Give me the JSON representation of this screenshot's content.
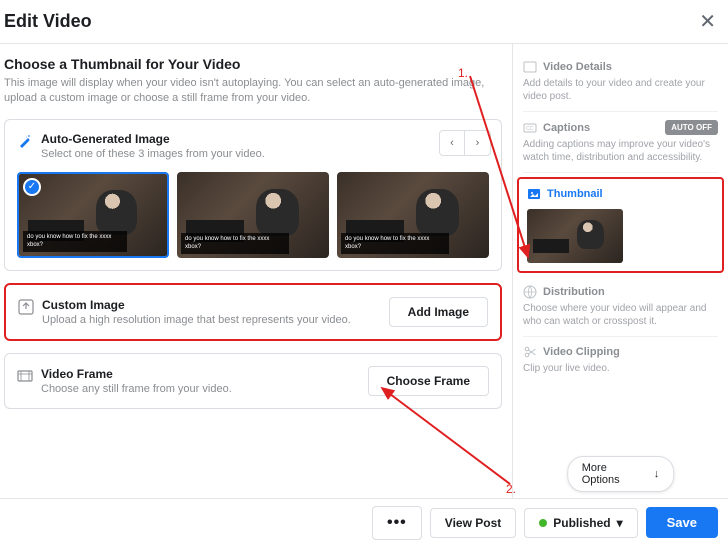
{
  "header": {
    "title": "Edit Video"
  },
  "choose": {
    "title": "Choose a Thumbnail for Your Video",
    "desc": "This image will display when your video isn't autoplaying. You can select an auto-generated image, upload a custom image or choose a still frame from your video."
  },
  "auto": {
    "title": "Auto-Generated Image",
    "sub": "Select one of these 3 images from your video.",
    "caption": "do you know how to fix the xxxx xbox?"
  },
  "custom": {
    "title": "Custom Image",
    "sub": "Upload a high resolution image that best represents your video.",
    "btn": "Add Image"
  },
  "frame": {
    "title": "Video Frame",
    "sub": "Choose any still frame from your video.",
    "btn": "Choose Frame"
  },
  "side": {
    "details": {
      "title": "Video Details",
      "desc": "Add details to your video and create your video post."
    },
    "captions": {
      "title": "Captions",
      "desc": "Adding captions may improve your video's watch time, distribution and accessibility.",
      "badge": "AUTO OFF"
    },
    "thumb": {
      "title": "Thumbnail"
    },
    "dist": {
      "title": "Distribution",
      "desc": "Choose where your video will appear and who can watch or crosspost it."
    },
    "clip": {
      "title": "Video Clipping",
      "desc": "Clip your live video."
    },
    "more": "More Options"
  },
  "footer": {
    "view": "View Post",
    "published": "Published",
    "save": "Save"
  },
  "annotations": {
    "one": "1.",
    "two": "2."
  }
}
